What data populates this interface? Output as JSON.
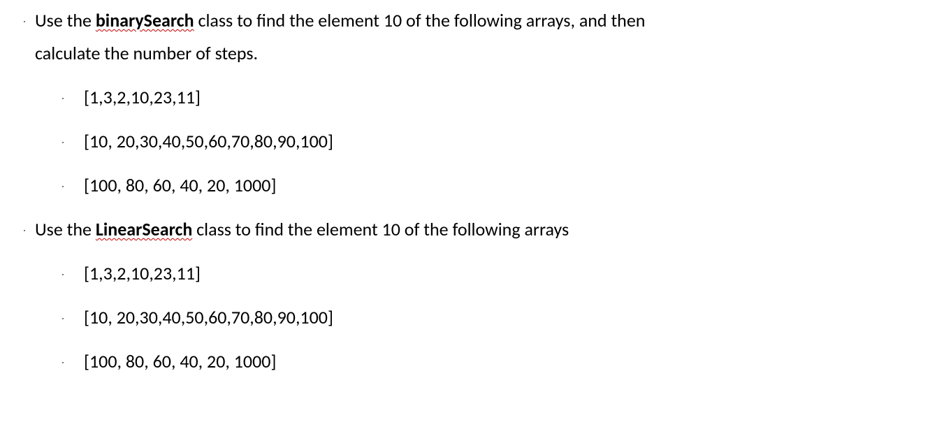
{
  "sections": [
    {
      "intro_pre": "Use the ",
      "keyword": "binarySearch",
      "intro_post": " class to find the element 10 of the following arrays, and then",
      "intro_cont": "calculate the number of steps.",
      "arrays": [
        "[1,3,2,10,23,11]",
        "[10, 20,30,40,50,60,70,80,90,100]",
        "[100, 80, 60, 40, 20, 1000]"
      ]
    },
    {
      "intro_pre": "Use the ",
      "keyword": "LinearSearch",
      "intro_post": " class to find the element 10 of the following arrays",
      "intro_cont": "",
      "arrays": [
        "[1,3,2,10,23,11]",
        "[10, 20,30,40,50,60,70,80,90,100]",
        "[100, 80, 60, 40, 20, 1000]"
      ]
    }
  ]
}
